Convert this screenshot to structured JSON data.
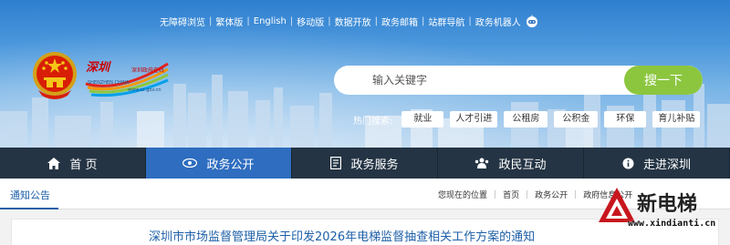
{
  "top_links": [
    "无障碍浏览",
    "繁体版",
    "English",
    "移动版",
    "数据开放",
    "政务邮箱",
    "站群导航",
    "政务机器人"
  ],
  "logo": {
    "brand_cn": "深圳政府在线",
    "brand_en": "SHENZHEN CHINA",
    "url": "www.sz.gov.cn"
  },
  "search": {
    "placeholder": "输入关键字",
    "button": "搜一下"
  },
  "hot": {
    "label": "热门搜索:",
    "tags": [
      "就业",
      "人才引进",
      "公租房",
      "公积金",
      "环保",
      "育儿补贴"
    ]
  },
  "nav": {
    "items": [
      {
        "label": "首 页",
        "icon": "home-icon"
      },
      {
        "label": "政务公开",
        "icon": "eye-icon"
      },
      {
        "label": "政务服务",
        "icon": "document-icon"
      },
      {
        "label": "政民互动",
        "icon": "people-icon"
      },
      {
        "label": "走进深圳",
        "icon": "info-icon"
      }
    ],
    "active_index": 1
  },
  "section": {
    "title": "通知公告"
  },
  "breadcrumb": {
    "label": "您现在的位置",
    "items": [
      "首页",
      "政务公开",
      "政府信息公开"
    ]
  },
  "article": {
    "title": "深圳市市场监督管理局关于印发2026年电梯监督抽查相关工作方案的通知"
  },
  "watermark": {
    "text": "新电梯",
    "url": "www.xindianti.cn"
  },
  "colors": {
    "nav_bg": "#243444",
    "nav_active": "#2e6dbf",
    "search_button": "#8cc63f",
    "link_blue": "#1d5fa8"
  }
}
